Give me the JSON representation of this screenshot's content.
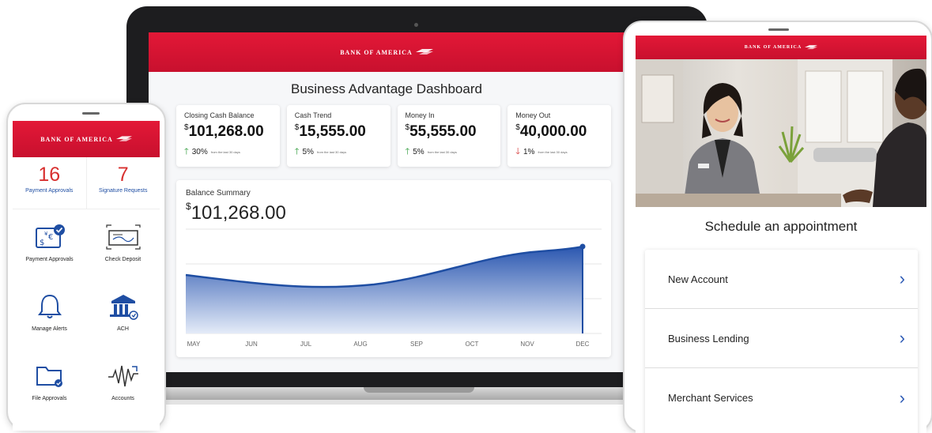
{
  "brand": {
    "name": "BANK OF AMERICA",
    "primary_red": "#c8102e",
    "accent_blue": "#2f5cb6"
  },
  "laptop": {
    "title": "Business Advantage Dashboard",
    "stats": [
      {
        "label": "Closing Cash Balance",
        "currency": "$",
        "value": "101,268.00",
        "direction": "up",
        "change": "30%",
        "change_note": "from the last 30 days"
      },
      {
        "label": "Cash Trend",
        "currency": "$",
        "value": "15,555.00",
        "direction": "up",
        "change": "5%",
        "change_note": "from the last 30 days"
      },
      {
        "label": "Money In",
        "currency": "$",
        "value": "55,555.00",
        "direction": "up",
        "change": "5%",
        "change_note": "from the last 30 days"
      },
      {
        "label": "Money Out",
        "currency": "$",
        "value": "40,000.00",
        "direction": "down",
        "change": "1%",
        "change_note": "from the last 30 days"
      }
    ],
    "balance_summary": {
      "label": "Balance Summary",
      "currency": "$",
      "value": "101,268.00",
      "months": [
        "MAY",
        "JUN",
        "JUL",
        "AUG",
        "SEP",
        "OCT",
        "NOV",
        "DEC"
      ]
    }
  },
  "phone": {
    "counts": [
      {
        "number": "16",
        "label": "Payment Approvals"
      },
      {
        "number": "7",
        "label": "Signature Requests"
      }
    ],
    "tiles": [
      {
        "label": "Payment Approvals",
        "icon": "currency-exchange-icon"
      },
      {
        "label": "Check Deposit",
        "icon": "check-icon"
      },
      {
        "label": "Manage Alerts",
        "icon": "bell-icon"
      },
      {
        "label": "ACH",
        "icon": "bank-icon"
      },
      {
        "label": "File Approvals",
        "icon": "folder-icon"
      },
      {
        "label": "Accounts",
        "icon": "waveform-icon"
      }
    ]
  },
  "tablet": {
    "title": "Schedule an appointment",
    "items": [
      {
        "label": "New Account"
      },
      {
        "label": "Business Lending"
      },
      {
        "label": "Merchant Services"
      }
    ]
  }
}
